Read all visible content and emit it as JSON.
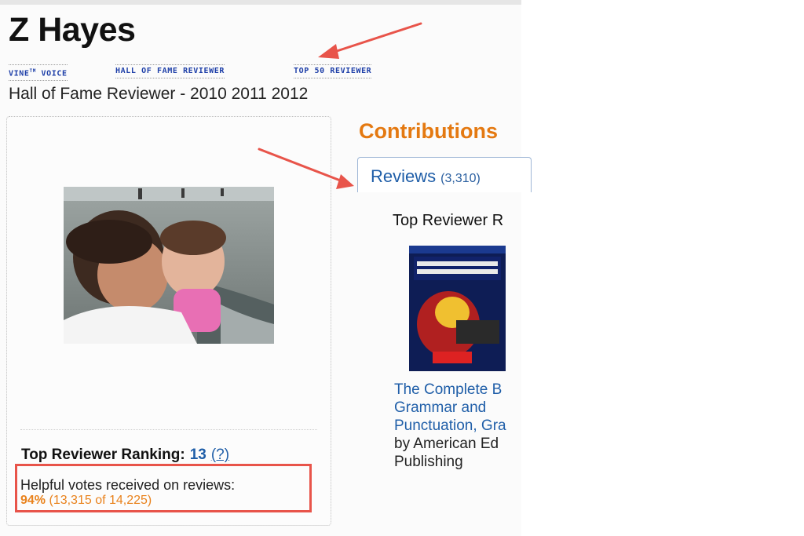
{
  "profile": {
    "name": "Z Hayes",
    "hall_of_fame_years": "Hall of Fame Reviewer - 2010 2011 2012"
  },
  "badges": [
    {
      "label": "VINE",
      "suffix": "TM",
      "after": " VOICE"
    },
    {
      "label": "HALL OF FAME REVIEWER"
    },
    {
      "label": "TOP 50 REVIEWER"
    }
  ],
  "stats": {
    "ranking_label": "Top Reviewer Ranking:",
    "ranking_value": "13",
    "ranking_help": "(?)",
    "helpful_label": "Helpful votes received on reviews:",
    "helpful_percent": "94%",
    "helpful_counts": "(13,315 of 14,225)",
    "helpful_percent_value": 0.94
  },
  "contributions": {
    "heading": "Contributions",
    "tab_label": "Reviews",
    "tab_count": "(3,310)",
    "section_heading": "Top Reviewer R",
    "book": {
      "title_line1": "The Complete B",
      "title_line2": "Grammar and",
      "title_line3": "Punctuation, Gra",
      "by_line1": "by American Ed",
      "by_line2": "Publishing"
    }
  },
  "colors": {
    "accent_orange": "#e47911",
    "link_blue": "#1f5ea8",
    "annotation_red": "#e8544a"
  },
  "icons": [
    "annotation-arrow-icon",
    "cover-image",
    "profile-photo"
  ]
}
